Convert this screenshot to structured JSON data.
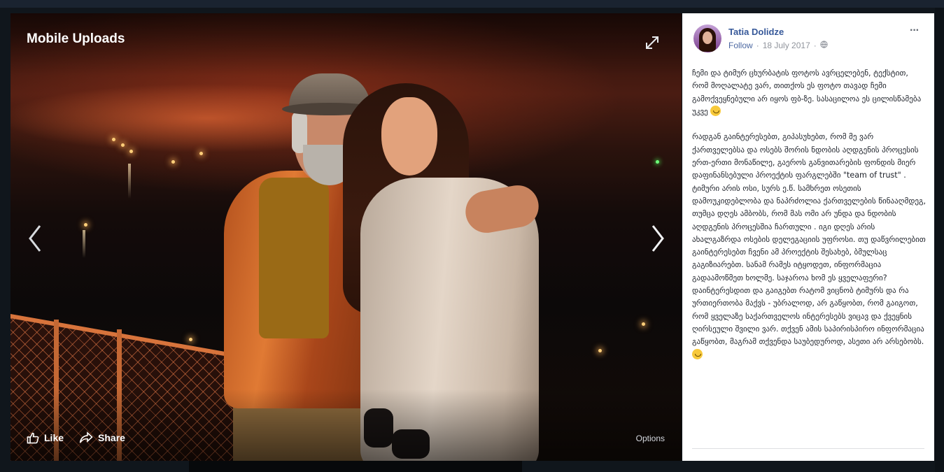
{
  "photo": {
    "album_title": "Mobile Uploads",
    "actions": {
      "like": "Like",
      "share": "Share",
      "options": "Options"
    },
    "icons": [
      "expand-icon",
      "chevron-left-icon",
      "chevron-right-icon",
      "like-icon",
      "share-icon"
    ]
  },
  "post": {
    "author": "Tatia Dolidze",
    "follow": "Follow",
    "separator": "·",
    "date": "18 July 2017",
    "privacy_icon": "globe-icon",
    "more": "···",
    "paragraph1": "ჩემი და ტიმურ ცხურბატის ფოტოს ავრცელებენ, ტექსტით, რომ მოღალატე ვარ, თითქოს ეს ფოტო თავად ჩემი გამოქვეყნებული არ იყოს ფბ-ზე. სასაცილოა ეს ცილისწამება უკვე",
    "paragraph2": "რადგან გაინტერესებთ, გიპასუხებთ, რომ მე ვარ ქართველებსა და ოსებს შორის ნდობის აღდგენის პროცესის ერთ-ერთი მონაწილე, გაეროს განვითარების ფონდის მიერ დაფინანსებული პროექტის ფარგლებში \"team of trust\" . ტიმური არის ოსი, სურს ე.წ. სამხრეთ ოსეთის დამოუკიდებლობა და ნაპრძოლია ქართველების წინააღმდეგ, თუმცა დღეს ამბობს, რომ მას ომი არ უნდა და ნდობის აღდგენის პროცესშია ჩართული . იგი დღეს არის ახალგაზრდა ოსების დელეგაციის უფროსი. თუ დაწვრილებით გაინტერესებთ ჩვენი ამ პროექტის შესახებ, ბმულსაც გაგიზიარებთ. სანამ რამეს იტყოდეთ, ინფორმაცია გადაამოწმეთ ხოლმე. საჯაროა ხომ ეს ყველაფერი? დაინტერესდით და გაიგებთ რატომ ვიცნობ ტიმურს და რა ურთიერთობა მაქვს - უბრალოდ, არ გაწყობთ, რომ გაიგოთ, რომ ყველაზე საქართველოს ინტერესებს ვიცავ და ქვეყნის ღირსეული შვილი ვარ. თქვენ ამის საპირისპირო ინფორმაცია გაწყობთ, მაგრამ თქვენდა საუბედუროდ, ასეთი არ არსებობს.",
    "emoji": "smile-emoji"
  }
}
